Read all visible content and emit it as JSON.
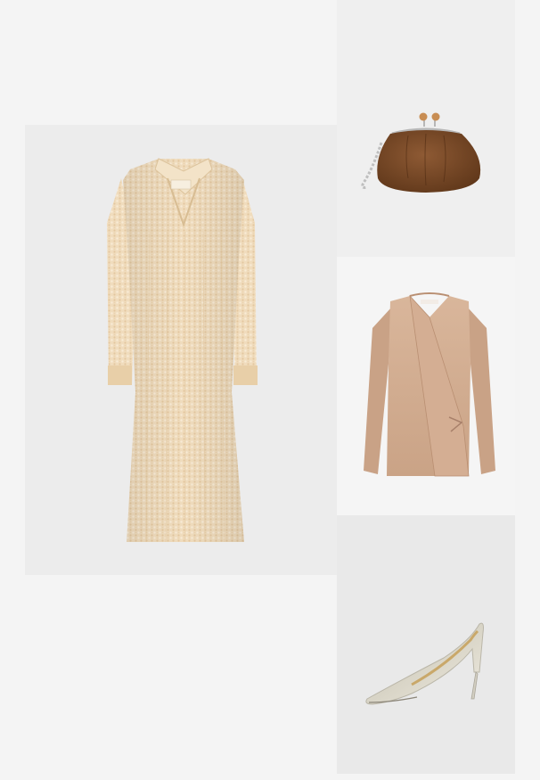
{
  "outfit": {
    "items": [
      {
        "id": "dress",
        "kind": "knit-polo-maxi-dress",
        "label_text": ""
      },
      {
        "id": "bag",
        "kind": "suede-frame-clutch-bag"
      },
      {
        "id": "cardigan",
        "kind": "wrap-cardigan"
      },
      {
        "id": "pumps",
        "kind": "metallic-pointed-pumps"
      }
    ],
    "colors": {
      "page_background": "#f4f4f4",
      "dress": "#efd9b8",
      "bag": "#7a4a2a",
      "cardigan": "#d4ae93",
      "pumps": "#e9e6da"
    }
  }
}
